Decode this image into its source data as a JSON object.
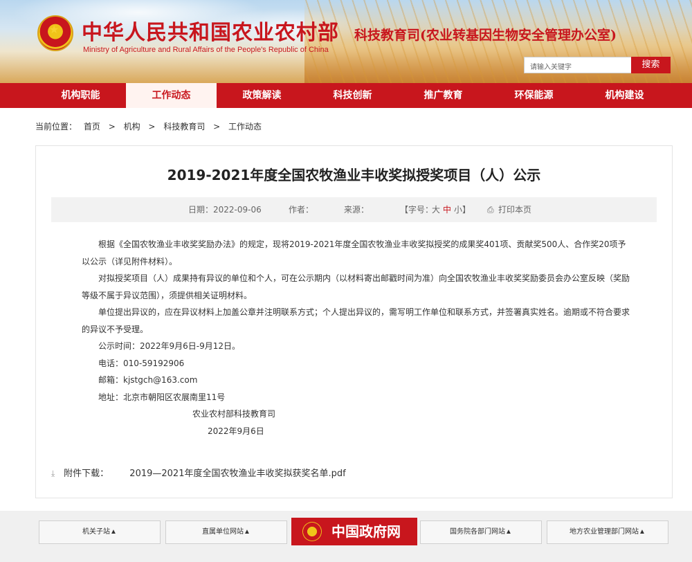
{
  "header": {
    "ministry_cn": "中华人民共和国农业农村部",
    "ministry_en": "Ministry of Agriculture and Rural Affairs of the People's Republic of China",
    "department": "科技教育司(农业转基因生物安全管理办公室)",
    "search_placeholder": "请输入关键字",
    "search_button": "搜索"
  },
  "nav": {
    "items": [
      "机构职能",
      "工作动态",
      "政策解读",
      "科技创新",
      "推广教育",
      "环保能源",
      "机构建设"
    ],
    "active_index": 1
  },
  "breadcrumb": {
    "label": "当前位置：",
    "items": [
      "首页",
      "机构",
      "科技教育司",
      "工作动态"
    ],
    "separator": ">"
  },
  "article": {
    "title": "2019-2021年度全国农牧渔业丰收奖拟授奖项目（人）公示",
    "meta": {
      "date_label": "日期：",
      "date": "2022-09-06",
      "author_label": "作者：",
      "source_label": "来源：",
      "font_label": "【字号：",
      "font_large": "大",
      "font_medium": "中",
      "font_small": "小】",
      "print_label": "打印本页"
    },
    "paragraphs": [
      "根据《全国农牧渔业丰收奖奖励办法》的规定，现将2019-2021年度全国农牧渔业丰收奖拟授奖的成果奖401项、贡献奖500人、合作奖20项予以公示（详见附件材料）。",
      "对拟授奖项目（人）成果持有异议的单位和个人，可在公示期内（以材料寄出邮戳时间为准）向全国农牧渔业丰收奖奖励委员会办公室反映（奖励等级不属于异议范围），须提供相关证明材料。",
      "单位提出异议的，应在异议材料上加盖公章并注明联系方式；个人提出异议的，需写明工作单位和联系方式，并签署真实姓名。逾期或不符合要求的异议不予受理。",
      "公示时间：2022年9月6日-9月12日。",
      "电话：010-59192906",
      "邮箱：kjstgch@163.com",
      "地址：北京市朝阳区农展南里11号"
    ],
    "signature_org": "农业农村部科技教育司",
    "signature_date": "2022年9月6日",
    "attachment_label": "附件下载：",
    "attachment_name": "2019—2021年度全国农牧渔业丰收奖拟获奖名单.pdf"
  },
  "footer": {
    "links": [
      "机关子站▲",
      "直属单位网站▲",
      "国务院各部门网站▲",
      "地方农业管理部门网站▲"
    ],
    "gov_logo": "中国政府网"
  },
  "colors": {
    "brand_red": "#c8161d"
  }
}
